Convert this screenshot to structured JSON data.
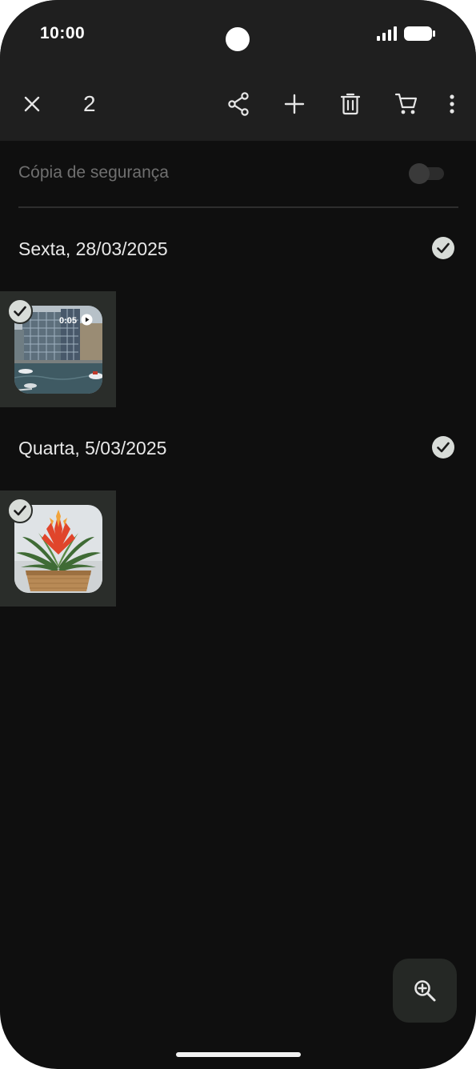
{
  "status_bar": {
    "time": "10:00"
  },
  "toolbar": {
    "selected_count": "2",
    "icons": [
      "close-icon",
      "share-icon",
      "add-icon",
      "delete-icon",
      "cart-icon",
      "more-vert-icon"
    ]
  },
  "backup": {
    "label": "Cópia de segurança",
    "enabled": false
  },
  "sections": [
    {
      "date": "Sexta, 28/03/2025",
      "selected": true,
      "items": [
        {
          "type": "video",
          "duration": "0:05",
          "selected": true,
          "subject": "waterfront building with boats"
        }
      ]
    },
    {
      "date": "Quarta, 5/03/2025",
      "selected": true,
      "items": [
        {
          "type": "photo",
          "selected": true,
          "subject": "potted bromeliad plant"
        }
      ]
    }
  ],
  "fab": {
    "icon": "zoom-in-icon"
  },
  "colors": {
    "background": "#0f0f0f",
    "app_bar": "#1f1f1f",
    "selected_tile": "#2a2d2a",
    "check_badge": "#d8dcd8",
    "text_primary": "#e8e8e8",
    "text_muted": "#6f6f6f"
  }
}
